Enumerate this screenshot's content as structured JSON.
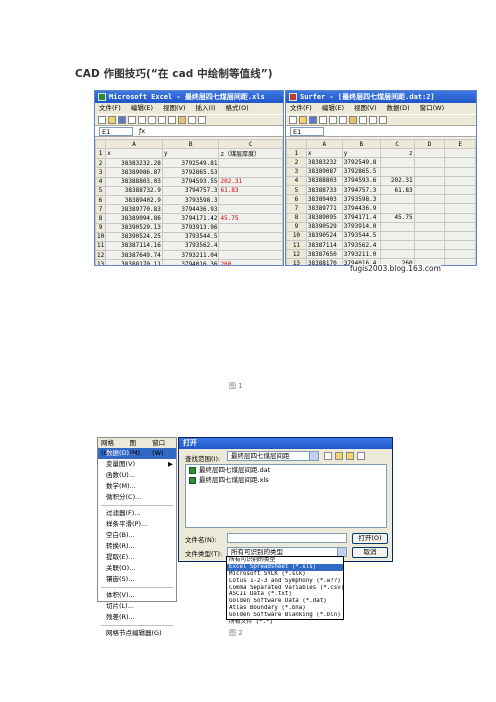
{
  "title": "CAD 作图技巧(“在 cad 中绘制等值线”)",
  "figure1": {
    "caption": "图 1",
    "excel": {
      "window_title": "Microsoft Excel - 最终层四七煤层间距.xls",
      "menu": [
        "文件(F)",
        "编辑(E)",
        "视图(V)",
        "插入(I)",
        "格式(O)"
      ],
      "namebox": "E1",
      "columns": [
        "A",
        "B",
        "C"
      ],
      "rows": [
        {
          "n": "1",
          "a": "x",
          "b": "y",
          "c": "z（煤层厚度）",
          "c_red": false
        },
        {
          "n": "2",
          "a": "38383232.28",
          "b": "3792549.81",
          "c": "",
          "c_red": false
        },
        {
          "n": "3",
          "a": "38389086.87",
          "b": "3792865.53",
          "c": "",
          "c_red": false
        },
        {
          "n": "4",
          "a": "38388803.03",
          "b": "3794593.55",
          "c": "202.31",
          "c_red": true
        },
        {
          "n": "5",
          "a": "38388732.9",
          "b": "3794757.3",
          "c": "61.83",
          "c_red": true
        },
        {
          "n": "6",
          "a": "38389402.9",
          "b": "3793598.3",
          "c": "",
          "c_red": false
        },
        {
          "n": "7",
          "a": "38389770.83",
          "b": "3794436.93",
          "c": "",
          "c_red": false
        },
        {
          "n": "8",
          "a": "38389094.86",
          "b": "3794171.42",
          "c": "45.75",
          "c_red": true
        },
        {
          "n": "9",
          "a": "38390529.13",
          "b": "3793913.96",
          "c": "",
          "c_red": false
        },
        {
          "n": "10",
          "a": "38390524.25",
          "b": "3793544.5",
          "c": "",
          "c_red": false
        },
        {
          "n": "11",
          "a": "38387114.16",
          "b": "3793562.4",
          "c": "",
          "c_red": false
        },
        {
          "n": "12",
          "a": "38387649.74",
          "b": "3793211.04",
          "c": "",
          "c_red": false
        },
        {
          "n": "13",
          "a": "38388170.11",
          "b": "3794016.36",
          "c": "260",
          "c_red": true
        },
        {
          "n": "14",
          "a": "38388462.71",
          "b": "3793939.25",
          "c": "82.33",
          "c_red": true
        },
        {
          "n": "15",
          "a": "38388051.45",
          "b": "3793375.83",
          "c": "55.2",
          "c_red": true
        },
        {
          "n": "16",
          "a": "38388144.29",
          "b": "3794107.49",
          "c": "330.63",
          "c_red": true
        },
        {
          "n": "17",
          "a": "38388541.82",
          "b": "3793601.41",
          "c": "",
          "c_red": false
        },
        {
          "n": "18",
          "a": "38388644.93",
          "b": "3793312.3",
          "c": "",
          "c_red": false
        },
        {
          "n": "19",
          "a": "38388730.14",
          "b": "3793077.64",
          "c": "",
          "c_red": false
        },
        {
          "n": "20",
          "a": "38388942.71",
          "b": "3793326.18",
          "c": "",
          "c_red": false
        }
      ]
    },
    "surfer": {
      "window_title": "Surfer - [最终层四七煤层间距.dat:2]",
      "menu": [
        "文件(F)",
        "编辑(E)",
        "视图(V)",
        "数据(D)",
        "窗口(W)"
      ],
      "namebox": "E1",
      "columns": [
        "A",
        "B",
        "C",
        "D",
        "E"
      ],
      "rows": [
        {
          "n": "1",
          "a": "x",
          "b": "y",
          "c": "z"
        },
        {
          "n": "2",
          "a": "38383232",
          "b": "3792549.8",
          "c": ""
        },
        {
          "n": "3",
          "a": "38389087",
          "b": "3792865.5",
          "c": ""
        },
        {
          "n": "4",
          "a": "38388803",
          "b": "3794593.6",
          "c": "202.31"
        },
        {
          "n": "5",
          "a": "38388733",
          "b": "3794757.3",
          "c": "61.83"
        },
        {
          "n": "6",
          "a": "38389403",
          "b": "3793598.3",
          "c": ""
        },
        {
          "n": "7",
          "a": "38389771",
          "b": "3794436.9",
          "c": ""
        },
        {
          "n": "8",
          "a": "38389095",
          "b": "3794171.4",
          "c": "45.75"
        },
        {
          "n": "9",
          "a": "38390529",
          "b": "3793914.0",
          "c": ""
        },
        {
          "n": "10",
          "a": "38390524",
          "b": "3793544.5",
          "c": ""
        },
        {
          "n": "11",
          "a": "38387114",
          "b": "3793562.4",
          "c": ""
        },
        {
          "n": "12",
          "a": "38387650",
          "b": "3793211.0",
          "c": ""
        },
        {
          "n": "13",
          "a": "38388170",
          "b": "3794016.4",
          "c": "260"
        },
        {
          "n": "14",
          "a": "38388463",
          "b": "3793939.3",
          "c": "82.33"
        },
        {
          "n": "15",
          "a": "38388051",
          "b": "3793375.8",
          "c": "55.2"
        },
        {
          "n": "16",
          "a": "38388144",
          "b": "3794107.5",
          "c": "330.63"
        },
        {
          "n": "17",
          "a": "38388542",
          "b": "3793601.4",
          "c": ""
        },
        {
          "n": "18",
          "a": "38388645",
          "b": "3793312.3",
          "c": ""
        },
        {
          "n": "19",
          "a": "38388730",
          "b": "3793077.6",
          "c": ""
        },
        {
          "n": "20",
          "a": "38388943",
          "b": "3793326.2",
          "c": ""
        }
      ]
    },
    "watermark": "fugis2003.blog.163.com"
  },
  "figure2": {
    "caption": "图 2",
    "menu_top": [
      "网格(G)",
      "图(M)",
      "窗口(W)"
    ],
    "menu_items": [
      {
        "label": "数据(D)...",
        "sel": true,
        "arrow": ""
      },
      {
        "label": "变量图(V)",
        "sel": false,
        "arrow": "▶"
      },
      {
        "label": "函数(U)...",
        "sel": false,
        "arrow": ""
      },
      {
        "label": "数学(M)...",
        "sel": false,
        "arrow": ""
      },
      {
        "label": "微积分(C)...",
        "sel": false,
        "arrow": ""
      },
      {
        "label": "sep",
        "sel": false,
        "arrow": ""
      },
      {
        "label": "过滤器(F)...",
        "sel": false,
        "arrow": ""
      },
      {
        "label": "样条平滑(P)...",
        "sel": false,
        "arrow": ""
      },
      {
        "label": "空白(B)...",
        "sel": false,
        "arrow": ""
      },
      {
        "label": "转换(R)...",
        "sel": false,
        "arrow": ""
      },
      {
        "label": "提取(E)...",
        "sel": false,
        "arrow": ""
      },
      {
        "label": "关联(O)...",
        "sel": false,
        "arrow": ""
      },
      {
        "label": "镶嵌(S)...",
        "sel": false,
        "arrow": ""
      },
      {
        "label": "sep",
        "sel": false,
        "arrow": ""
      },
      {
        "label": "体积(V)...",
        "sel": false,
        "arrow": ""
      },
      {
        "label": "切片(L)...",
        "sel": false,
        "arrow": ""
      },
      {
        "label": "残差(R)...",
        "sel": false,
        "arrow": ""
      },
      {
        "label": "sep",
        "sel": false,
        "arrow": ""
      },
      {
        "label": "网格节点编辑器(G)",
        "sel": false,
        "arrow": ""
      }
    ],
    "dialog": {
      "title": "打开",
      "look_in_label": "查找范围(I):",
      "look_in_value": "最终层四七煤层间距",
      "files": [
        "最终层四七煤层间距.dat",
        "最终层四七煤层间距.xls"
      ],
      "filename_label": "文件名(N):",
      "filetype_label": "文件类型(T):",
      "filetype_value": "所有可识别的类型",
      "open_button": "打开(O)",
      "cancel_button": "取消"
    },
    "filetypes": [
      "所有可识别的类型",
      "Excel Spreadsheet (*.xls)",
      "Microsoft SYLK (*.slk)",
      "Lotus 1-2-3 and Symphony (*.w??)",
      "Comma Separated Variables (*.csv)",
      "ASCII Data (*.txt)",
      "Golden Software Data (*.dat)",
      "Atlas Boundary (*.bna)",
      "Golden Software Blanking (*.bln)",
      "所有文件 (*.*)"
    ],
    "selected_filetype_index": 1
  }
}
